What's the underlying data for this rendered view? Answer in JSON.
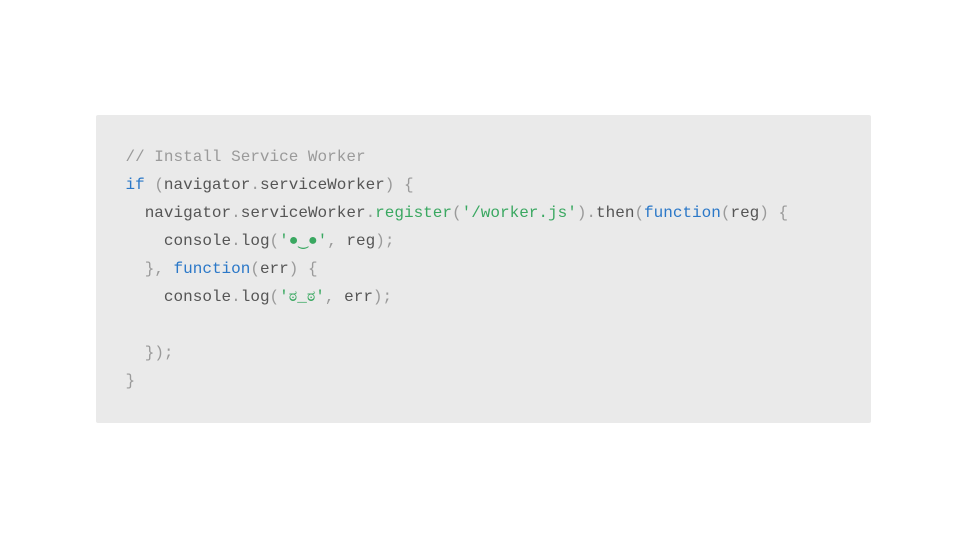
{
  "code": {
    "line1": {
      "comment": "// Install Service Worker"
    },
    "line2": {
      "kw_if": "if",
      "sp1": " ",
      "p_open": "(",
      "navigator": "navigator",
      "dot1": ".",
      "serviceWorker": "serviceWorker",
      "p_close": ")",
      "sp2": " ",
      "brace_open": "{"
    },
    "line3": {
      "indent": "  ",
      "navigator": "navigator",
      "dot1": ".",
      "serviceWorker": "serviceWorker",
      "dot2": ".",
      "register": "register",
      "p_open": "(",
      "path": "'/worker.js'",
      "p_close": ")",
      "dot3": ".",
      "then": "then",
      "p_open2": "(",
      "kw_function": "function",
      "p_open3": "(",
      "reg": "reg",
      "p_close3": ")",
      "sp": " ",
      "brace_open": "{"
    },
    "line4": {
      "indent": "    ",
      "console": "console",
      "dot": ".",
      "log": "log",
      "p_open": "(",
      "str": "'●‿●'",
      "comma": ",",
      "sp": " ",
      "reg": "reg",
      "p_close": ")",
      "semi": ";"
    },
    "line5": {
      "indent": "  ",
      "brace_close": "}",
      "comma": ",",
      "sp": " ",
      "kw_function": "function",
      "p_open": "(",
      "err": "err",
      "p_close": ")",
      "sp2": " ",
      "brace_open": "{"
    },
    "line6": {
      "indent": "    ",
      "console": "console",
      "dot": ".",
      "log": "log",
      "p_open": "(",
      "str": "'ಠ_ಠ'",
      "comma": ",",
      "sp": " ",
      "err": "err",
      "p_close": ")",
      "semi": ";"
    },
    "line7": {
      "blank": ""
    },
    "line8": {
      "indent": "  ",
      "brace_close": "}",
      "p_close": ")",
      "semi": ";"
    },
    "line9": {
      "brace_close": "}"
    }
  }
}
